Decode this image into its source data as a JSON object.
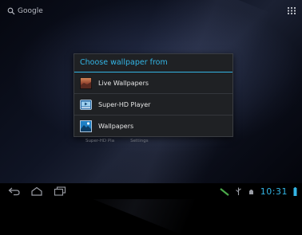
{
  "search": {
    "label": "Google"
  },
  "dialog": {
    "title": "Choose wallpaper from",
    "options": [
      {
        "label": "Live Wallpapers",
        "icon": "live-wallpapers-icon"
      },
      {
        "label": "Super-HD Player",
        "icon": "super-hd-player-icon"
      },
      {
        "label": "Wallpapers",
        "icon": "wallpapers-icon"
      }
    ]
  },
  "background_labels": [
    "Super-HD Pla",
    "Settings"
  ],
  "status": {
    "time": "10:31"
  },
  "colors": {
    "accent": "#33b5e5",
    "dialog_bg": "#1f2124"
  }
}
